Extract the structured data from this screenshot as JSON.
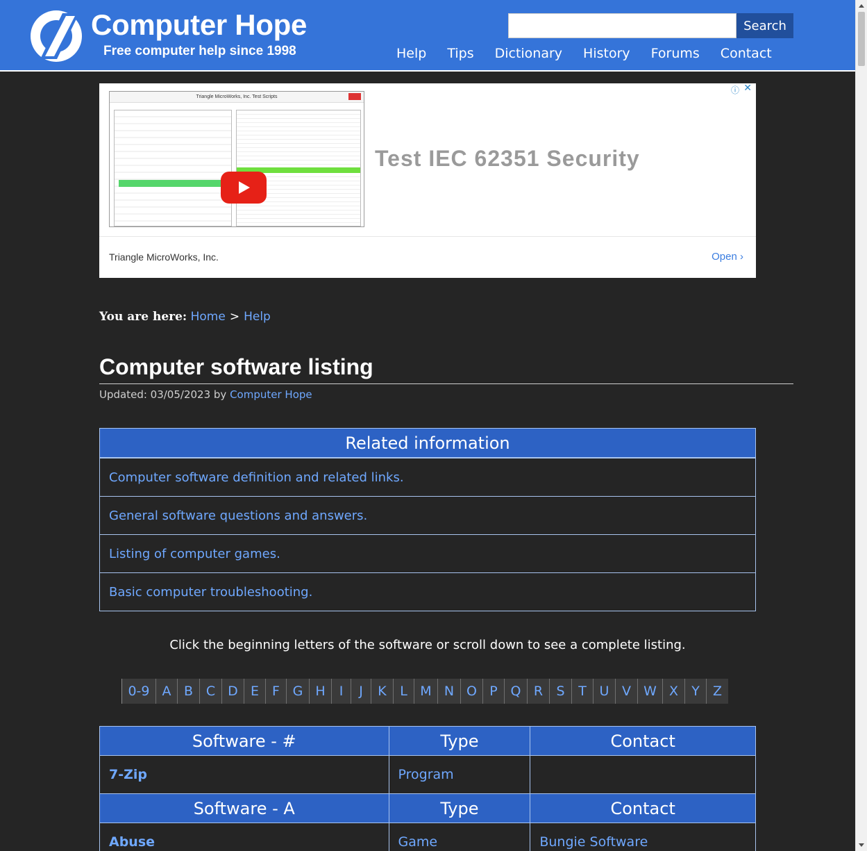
{
  "header": {
    "logo_title": "Computer Hope",
    "tagline": "Free computer help since 1998",
    "search_button": "Search",
    "search_value": "",
    "nav": [
      "Help",
      "Tips",
      "Dictionary",
      "History",
      "Forums",
      "Contact"
    ]
  },
  "ad": {
    "headline": "Test IEC 62351 Security",
    "advertiser": "Triangle MicroWorks, Inc.",
    "open_label": "Open ›",
    "info_icon": "info-icon",
    "close_icon": "close-icon",
    "window_title": "Triangle MicroWorks, Inc. Test Scripts"
  },
  "breadcrumb": {
    "prefix": "You are here:",
    "items": [
      "Home",
      "Help"
    ],
    "separator": ">"
  },
  "page": {
    "title": "Computer software listing",
    "updated_label": "Updated: 03/05/2023 by",
    "updated_author": "Computer Hope"
  },
  "related": {
    "heading": "Related information",
    "links": [
      "Computer software definition and related links.",
      "General software questions and answers.",
      "Listing of computer games.",
      "Basic computer troubleshooting."
    ]
  },
  "instruction": "Click the beginning letters of the software or scroll down to see a complete listing.",
  "letters": [
    "0-9",
    "A",
    "B",
    "C",
    "D",
    "E",
    "F",
    "G",
    "H",
    "I",
    "J",
    "K",
    "L",
    "M",
    "N",
    "O",
    "P",
    "Q",
    "R",
    "S",
    "T",
    "U",
    "V",
    "W",
    "X",
    "Y",
    "Z"
  ],
  "software_table": {
    "sections": [
      {
        "headers": [
          "Software - #",
          "Type",
          "Contact"
        ],
        "rows": [
          [
            "7-Zip",
            "Program",
            ""
          ]
        ]
      },
      {
        "headers": [
          "Software - A",
          "Type",
          "Contact"
        ],
        "rows": [
          [
            "Abuse",
            "Game",
            "Bungie Software"
          ]
        ]
      }
    ]
  },
  "colors": {
    "header_bg": "#3574d9",
    "page_bg": "#252525",
    "link": "#6fa8ff",
    "table_header": "#2d62c4"
  }
}
